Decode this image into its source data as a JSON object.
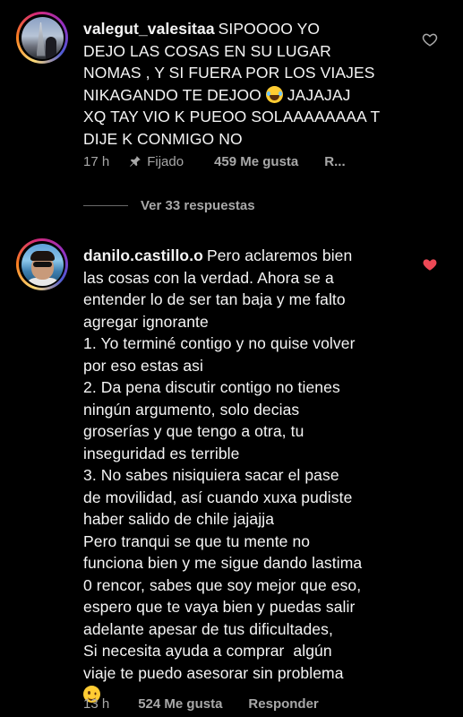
{
  "comments": [
    {
      "username": "valegut_valesitaa",
      "text_part1": "SIPOOOO YO\nDEJO LAS COSAS EN SU LUGAR\nNOMAS , Y SI FUERA POR LOS VIAJES\nNIKAGANDO TE DEJOO ",
      "emoji_1": "face-with-tears-of-joy-emoji",
      "text_part2": " JAJAJAJ\nXQ TAY VIO K PUEOO SOLAAAAAAAA T\nDIJE K CONMIGO NO",
      "time": "17 h",
      "pinned_label": "Fijado",
      "likes": "459 Me gusta",
      "reply_label": "R...",
      "liked": false,
      "view_replies": "Ver 33 respuestas"
    },
    {
      "username": "danilo.castillo.o",
      "text_part1": "Pero aclaremos bien\nlas cosas con la verdad. Ahora se a\nentender lo de ser tan baja y me falto\nagregar ignorante\n1. Yo terminé contigo y no quise volver\npor eso estas asi\n2. Da pena discutir contigo no tienes\nningún argumento, solo decias\ngroserías y que tengo a otra, tu\ninseguridad es terrible\n3. No sabes nisiquiera sacar el pase\nde movilidad, así cuando xuxa pudiste\nhaber salido de chile jajajja\nPero tranqui se que tu mente no\nfunciona bien y me sigue dando lastima\n0 rencor, sabes que soy mejor que eso,\nespero que te vaya bien y puedas salir\nadelante apesar de tus dificultades,\nSi necesita ayuda a comprar  algún\nviaje te puedo asesorar sin problema\n",
      "emoji_1": "winking-face-emoji",
      "time": "13 h",
      "likes": "524 Me gusta",
      "reply_label": "Responder",
      "liked": true
    }
  ],
  "colors": {
    "background": "#000000",
    "text": "#f5f5f5",
    "meta": "#a8a8a8",
    "heart_liked": "#ed4956",
    "heart_outline": "#a8a8a8"
  },
  "icons": {
    "pin": "pin-icon",
    "heart_outline": "heart-outline-icon",
    "heart_filled": "heart-filled-icon"
  }
}
